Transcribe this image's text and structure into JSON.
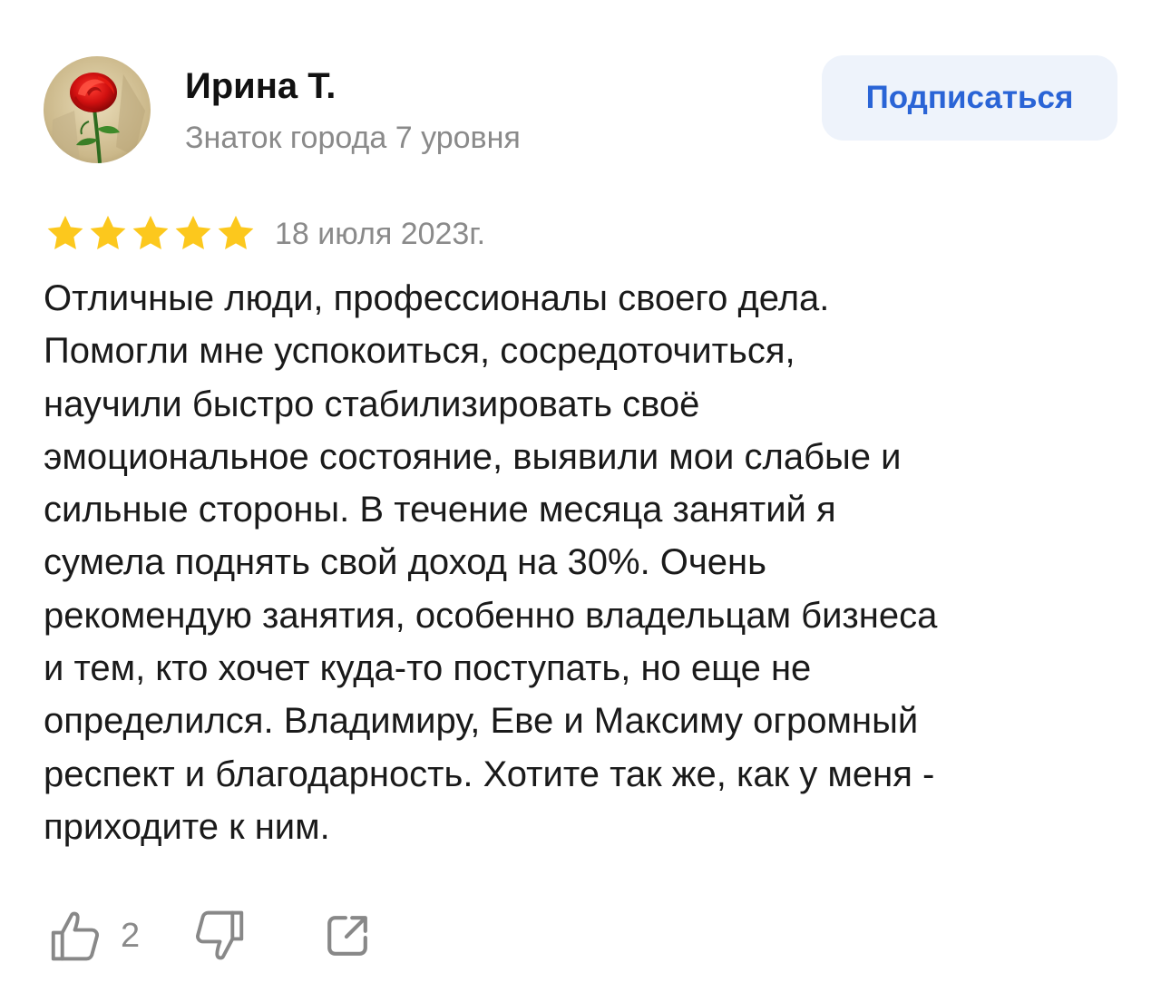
{
  "author": {
    "name": "Ирина Т.",
    "level": "Знаток города 7 уровня",
    "avatar_icon": "red-rose-avatar"
  },
  "subscribe_label": "Подписаться",
  "review": {
    "rating": 5,
    "rating_max": 5,
    "date": "18 июля 2023г.",
    "lines": [
      "Отличные люди, профессионалы своего дела.",
      "Помогли мне успокоиться, сосредоточиться,",
      "научили быстро стабилизировать своё",
      "эмоциональное состояние, выявили мои слабые и",
      "сильные стороны. В течение месяца занятий я",
      "сумела поднять свой доход на 30%.  Очень",
      "рекомендую занятия, особенно владельцам бизнеса",
      "и тем, кто хочет куда-то поступать, но еще не",
      "определился. Владимиру, Еве и Максиму огромный",
      "респект и благодарность. Хотите так же, как  у меня -",
      "приходите к ним."
    ]
  },
  "actions": {
    "like_count": "2",
    "like_icon": "thumbs-up-icon",
    "dislike_icon": "thumbs-down-icon",
    "share_icon": "share-icon"
  },
  "colors": {
    "accent": "#2a64d6",
    "button_bg": "#eef3fb",
    "star": "#fcc81d",
    "muted": "#8a8a8a",
    "text": "#1a1a1a"
  }
}
